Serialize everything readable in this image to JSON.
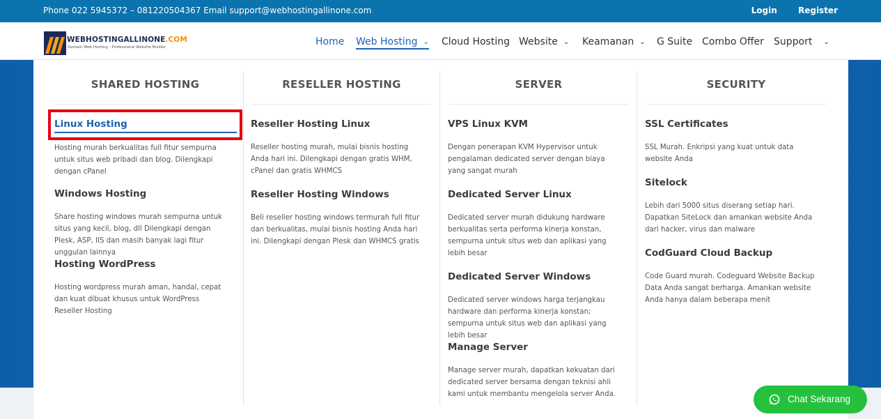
{
  "topbar": {
    "contact": "Phone 022 5945372 – 081220504367  Email support@webhostingallinone.com",
    "login": "Login",
    "register": "Register"
  },
  "logo": {
    "name": "WEBHOSTINGALLINONE",
    "tld": ".COM",
    "tagline": "Domain Web Hosting - Professional Website Builder"
  },
  "nav": {
    "items": [
      {
        "label": "Home"
      },
      {
        "label": "Web Hosting"
      },
      {
        "label": "Cloud Hosting"
      },
      {
        "label": "Website"
      },
      {
        "label": "Keamanan"
      },
      {
        "label": "G Suite"
      },
      {
        "label": "Combo Offer"
      },
      {
        "label": "Support"
      }
    ],
    "active": "Web Hosting"
  },
  "menu": {
    "columns": [
      {
        "heading": "SHARED HOSTING",
        "entries": [
          {
            "title": "Linux Hosting",
            "desc": "Hosting murah berkualitas full fitur sempurna untuk situs web pribadi dan blog. Dilengkapi dengan cPanel"
          },
          {
            "title": "Windows Hosting",
            "desc": "Share hosting windows murah sempurna untuk situs yang kecil, blog, dll Dilengkapi dengan Plesk, ASP, IIS dan masih banyak lagi fitur unggulan lainnya"
          },
          {
            "title": "Hosting WordPress",
            "desc": "Hosting wordpress murah aman, handal, cepat dan kuat dibuat khusus untuk WordPress Reseller Hosting"
          }
        ]
      },
      {
        "heading": "RESELLER HOSTING",
        "entries": [
          {
            "title": "Reseller Hosting Linux",
            "desc": "Reseller hosting murah, mulai bisnis hosting Anda hari ini. Dilengkapi dengan gratis WHM, cPanel dan gratis WHMCS"
          },
          {
            "title": "Reseller Hosting Windows",
            "desc": "Beli reseller hosting windows termurah full fitur dan berkualitas, mulai bisnis hosting Anda hari ini. Dilengkapi dengan Plesk dan WHMCS gratis"
          }
        ]
      },
      {
        "heading": "SERVER",
        "entries": [
          {
            "title": "VPS Linux KVM",
            "desc": "Dengan penerapan KVM Hypervisor untuk pengalaman dedicated server dengan biaya yang sangat murah"
          },
          {
            "title": "Dedicated Server Linux",
            "desc": "Dedicated server murah didukung hardware berkualitas serta performa kinerja konstan, sempurna untuk situs web dan aplikasi yang lebih besar"
          },
          {
            "title": "Dedicated Server Windows",
            "desc": "Dedicated server windows harga terjangkau hardware dan performa kinerja konstan; sempurna untuk situs web dan aplikasi yang lebih besar"
          },
          {
            "title": "Manage Server",
            "desc": "Manage server murah, dapatkan kekuatan dari dedicated server bersama dengan teknisi ahli kami untuk membantu mengelola server Anda."
          }
        ]
      },
      {
        "heading": "SECURITY",
        "entries": [
          {
            "title": "SSL Certificates",
            "desc": "SSL Murah. Enkripsi yang kuat untuk data website Anda"
          },
          {
            "title": "Sitelock",
            "desc": "Lebih dari 5000 situs diserang setiap hari. Dapatkan SiteLock dan amankan website Anda dari hacker, virus dan malware"
          },
          {
            "title": "CodGuard Cloud Backup",
            "desc": "Code Guard murah. Codeguard Website Backup Data Anda sangat berharga. Amankan website Anda hanya dalam beberapa menit"
          }
        ]
      }
    ]
  },
  "chat": {
    "label": "Chat Sekarang"
  },
  "colors": {
    "topbar": "#0b73ad",
    "accent": "#1e63b4",
    "highlight": "#e30613",
    "chat": "#25c13d"
  }
}
